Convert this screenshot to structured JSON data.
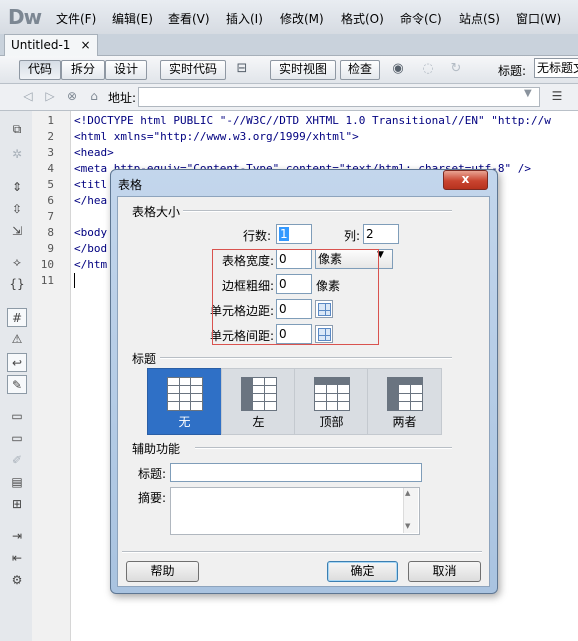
{
  "app": {
    "logo": "Dw"
  },
  "menu": [
    "文件(F)",
    "编辑(E)",
    "查看(V)",
    "插入(I)",
    "修改(M)",
    "格式(O)",
    "命令(C)",
    "站点(S)",
    "窗口(W)"
  ],
  "doc_tab": {
    "label": "Untitled-1",
    "close": "×"
  },
  "doc_toolbar": {
    "code": "代码",
    "split": "拆分",
    "design": "设计",
    "live_code": "实时代码",
    "live_view": "实时视图",
    "inspect": "检查",
    "title_label": "标题:",
    "title_value": "无标题文档"
  },
  "address": {
    "label": "地址:",
    "value": ""
  },
  "line_numbers": [
    "1",
    "2",
    "3",
    "4",
    "5",
    "6",
    "7",
    "8",
    "9",
    "10",
    "11"
  ],
  "code_lines": [
    "<!DOCTYPE html PUBLIC \"-//W3C//DTD XHTML 1.0 Transitional//EN\" \"http://w",
    "<html xmlns=\"http://www.w3.org/1999/xhtml\">",
    "<head>",
    "<meta http-equiv=\"Content-Type\" content=\"text/html; charset=utf-8\" />",
    "<titl",
    "</hea",
    "",
    "<body",
    "</bod",
    "</htm",
    ""
  ],
  "dialog": {
    "title": "表格",
    "close": "x",
    "size_group": "表格大小",
    "rows_label": "行数:",
    "rows_value": "1",
    "cols_label": "列:",
    "cols_value": "2",
    "width_label": "表格宽度:",
    "width_value": "0",
    "width_unit": "像素",
    "border_label": "边框粗细:",
    "border_value": "0",
    "border_unit": "像素",
    "padding_label": "单元格边距:",
    "padding_value": "0",
    "spacing_label": "单元格间距:",
    "spacing_value": "0",
    "header_group": "标题",
    "header_options": [
      "无",
      "左",
      "顶部",
      "两者"
    ],
    "header_selected": "无",
    "access_group": "辅助功能",
    "caption_label": "标题:",
    "caption_value": "",
    "summary_label": "摘要:",
    "summary_value": "",
    "help": "帮助",
    "ok": "确定",
    "cancel": "取消"
  }
}
